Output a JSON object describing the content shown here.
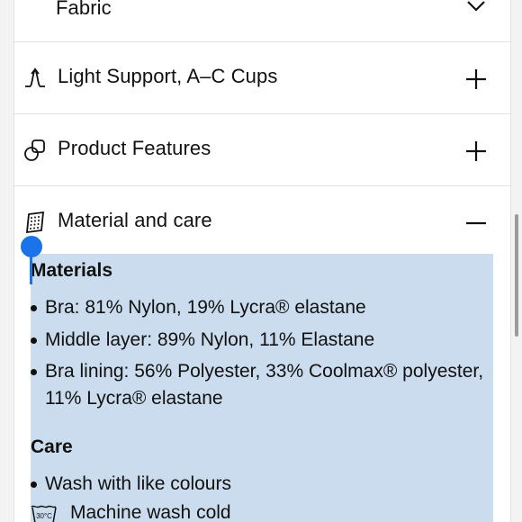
{
  "accordion": {
    "fabric": {
      "label": "Fabric"
    },
    "support": {
      "label": "Light Support, A–C Cups",
      "icon": "support-level-icon",
      "toggle": "plus"
    },
    "features": {
      "label": "Product Features",
      "icon": "product-features-icon",
      "toggle": "plus"
    },
    "material_care": {
      "label": "Material and care",
      "icon": "fabric-swatch-icon",
      "toggle": "minus",
      "materials_heading": "Materials",
      "materials": [
        "Bra: 81% Nylon, 19% Lycra® elastane",
        "Middle layer: 89% Nylon, 11% Elastane",
        [
          "Bra lining: 56% Polyester, 33% Coolmax® polyester,",
          "11% Lycra® elastane"
        ]
      ],
      "care_heading": "Care",
      "care": [
        "Wash with like colours",
        {
          "icon": "wash-30c-icon",
          "icon_text": "30°C",
          "text": "Machine wash cold"
        }
      ]
    }
  },
  "colors": {
    "selection": "#cadcee",
    "selection_handle": "#1a73e8",
    "divider": "#e3e3e3",
    "scrollbar": "#9b9b9b"
  }
}
